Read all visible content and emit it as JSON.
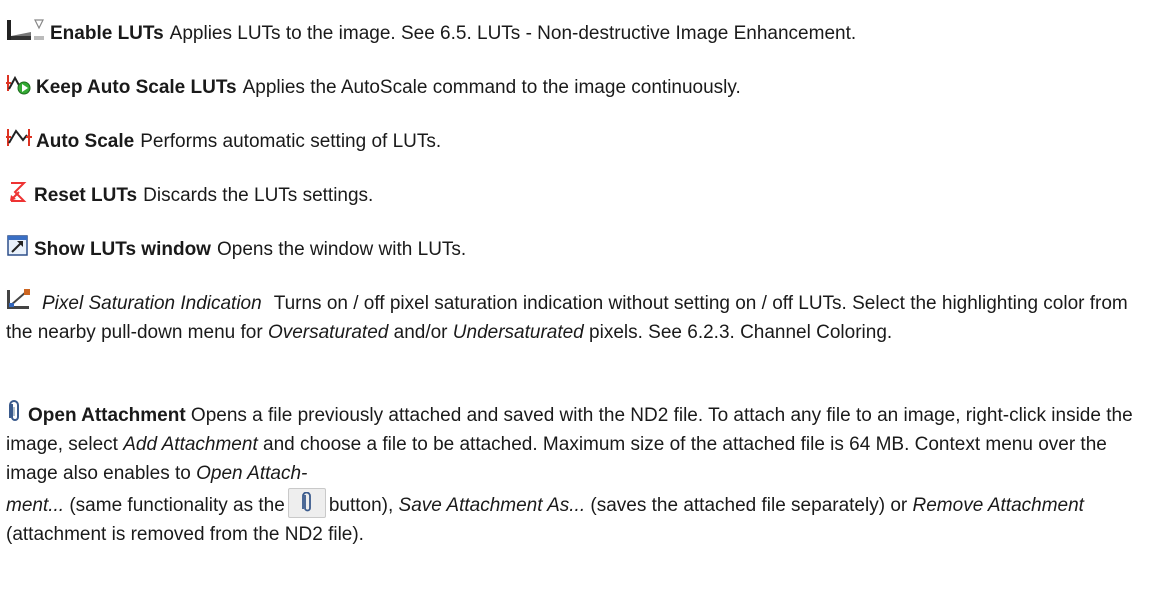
{
  "entries": [
    {
      "icon": "enable-luts-icon",
      "title": "Enable LUTs",
      "desc": "Applies LUTs to the image. See 6.5. LUTs - Non-destructive Image Enhancement."
    },
    {
      "icon": "keep-auto-scale-icon",
      "title": "Keep Auto Scale LUTs",
      "desc": "Applies the AutoScale command to the image continuously."
    },
    {
      "icon": "auto-scale-icon",
      "title": "Auto Scale",
      "desc": "Performs automatic setting of LUTs."
    },
    {
      "icon": "reset-luts-icon",
      "title": "Reset LUTs",
      "desc": "Discards the LUTs settings."
    },
    {
      "icon": "show-luts-window-icon",
      "title": "Show LUTs window",
      "desc": "Opens the window with LUTs."
    },
    {
      "icon": "pixel-saturation-icon",
      "title": "Pixel Saturation Indication",
      "desc_a": "Turns on / off pixel saturation indication without setting on / off LUTs. Select the highlighting color from the nearby pull-down menu for",
      "oversaturated": "Oversaturated",
      "and_or": "and/or",
      "undersaturated": "Undersaturated",
      "desc_b": "pixels. See 6.2.3. Channel Coloring."
    },
    {
      "icon": "paperclip-icon",
      "title": "Open Attachment",
      "desc_a": "Opens a file previously attached and saved with the ND2 file. To attach any file to an image, right-click inside the image, select",
      "add_attachment": "Add Attachment",
      "desc_b": "and choose a file to be attached. Maximum size of the attached file is 64 MB. Context menu over the image also enables to",
      "open_attach_1": "Open Attach-",
      "open_attach_2": "ment...",
      "desc_c": "(same functionality as the",
      "desc_d": "button),",
      "save_attachment": "Save Attachment As...",
      "desc_e": "(saves the attached file separately) or",
      "remove_attachment": "Remove Attachment",
      "desc_f": "(attachment is removed from the ND2 file)."
    }
  ]
}
